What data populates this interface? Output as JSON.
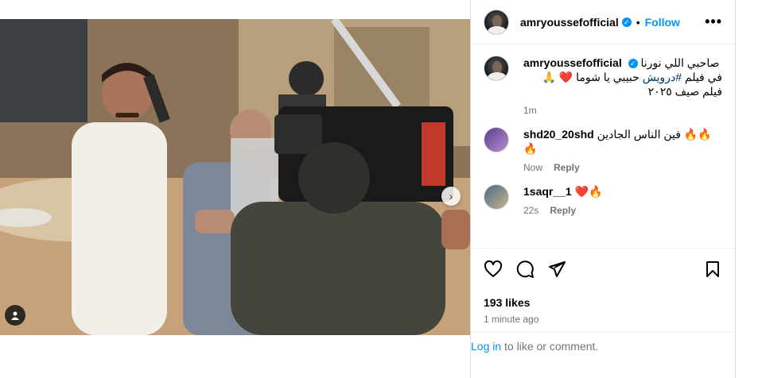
{
  "post": {
    "username": "amryoussefofficial",
    "separator": "•",
    "follow_label": "Follow",
    "more_label": "•••"
  },
  "caption": {
    "username": "amryoussefofficial",
    "line1": "صاحبي اللي نورنا",
    "line2_prefix": "في فيلم ",
    "hashtag": "#درويش",
    "line2_suffix": " حبيبي يا شوما ❤️ 🙏",
    "line3": "فيلم صيف ٢٠٢٥",
    "time": "1m"
  },
  "comments": [
    {
      "username": "shd20_20shd",
      "text": "فين الناس الجادين 🔥🔥🔥",
      "time": "Now",
      "reply_label": "Reply"
    },
    {
      "username": "1saqr__1",
      "text": "❤️🔥",
      "time": "22s",
      "reply_label": "Reply"
    }
  ],
  "stats": {
    "likes": "193 likes",
    "posted": "1 minute ago"
  },
  "login": {
    "link_label": "Log in",
    "rest": " to like or comment."
  },
  "carousel": {
    "total_slides": 2,
    "current_slide": 1
  },
  "icons": [
    "heart-icon",
    "comment-icon",
    "share-icon",
    "save-icon",
    "user-tag-icon",
    "chevron-right-icon",
    "more-icon",
    "verified-icon"
  ],
  "colors": {
    "accent": "#0095f6",
    "hashtag": "#00376b",
    "muted": "#737373",
    "heart": "#ed4956"
  }
}
